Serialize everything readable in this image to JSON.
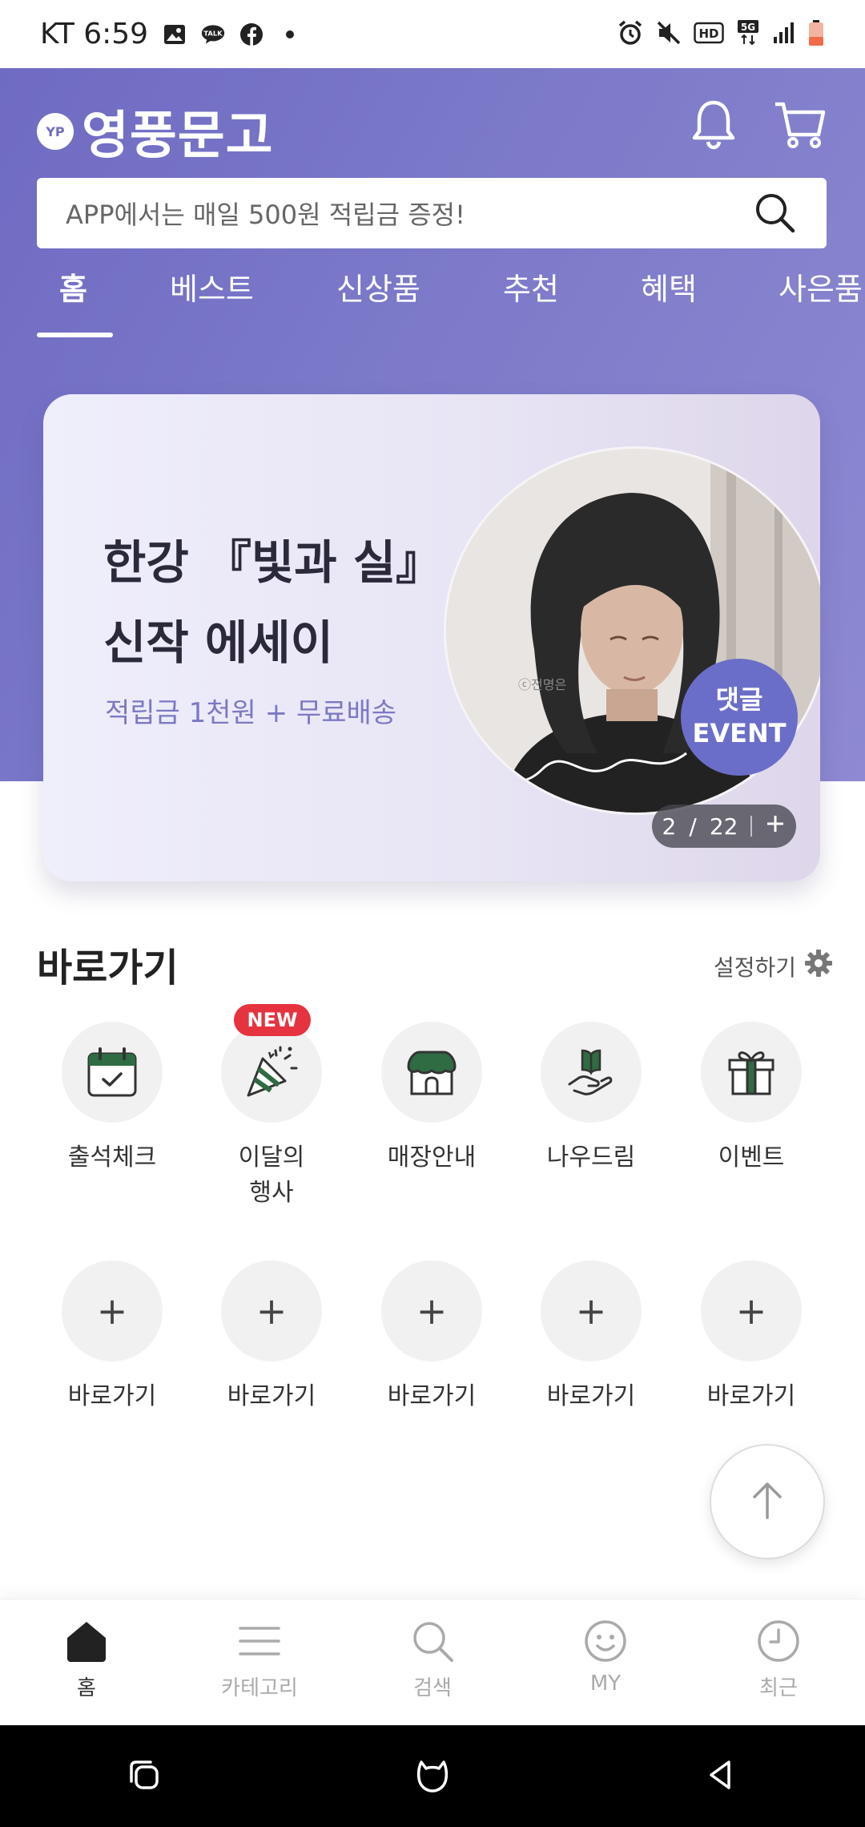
{
  "status_bar": {
    "carrier_time": "KT 6:59",
    "icons": [
      "image-icon",
      "talk-icon",
      "facebook-icon",
      "dot-icon",
      "alarm-icon",
      "mute-icon",
      "hd-icon",
      "5g-icon",
      "signal-icon",
      "battery-icon"
    ]
  },
  "header": {
    "brand_name": "영풍문고",
    "brand_logo_text": "YP",
    "search_placeholder": "APP에서는 매일 500원 적립금 증정!"
  },
  "tabs": [
    {
      "label": "홈",
      "active": true
    },
    {
      "label": "베스트"
    },
    {
      "label": "신상품"
    },
    {
      "label": "추천"
    },
    {
      "label": "혜택"
    },
    {
      "label": "사은품"
    }
  ],
  "banner": {
    "title_line1": "한강 『빛과 실』",
    "title_line2": "신작 에세이",
    "subtitle": "적립금 1천원 + 무료배송",
    "photo_credit": "ⓒ전명은",
    "badge_line1": "댓글",
    "badge_line2": "EVENT",
    "pager_current": "2",
    "pager_sep": "/",
    "pager_total": "22"
  },
  "shortcuts": {
    "title": "바로가기",
    "setting_label": "설정하기",
    "new_badge": "NEW",
    "items": [
      {
        "label": "출석체크",
        "icon": "calendar-check-icon"
      },
      {
        "label_line1": "이달의",
        "label_line2": "행사",
        "icon": "party-popper-icon"
      },
      {
        "label": "매장안내",
        "icon": "store-icon"
      },
      {
        "label": "나우드림",
        "icon": "book-hand-icon"
      },
      {
        "label": "이벤트",
        "icon": "gift-icon"
      }
    ],
    "empty_label": "바로가기"
  },
  "bottom_nav": [
    {
      "label": "홈",
      "icon": "home-icon",
      "active": true
    },
    {
      "label": "카테고리",
      "icon": "menu-icon"
    },
    {
      "label": "검색",
      "icon": "search-icon"
    },
    {
      "label": "MY",
      "icon": "smile-icon"
    },
    {
      "label": "최근",
      "icon": "clock-icon"
    }
  ],
  "colors": {
    "brand": "#6f6bc3",
    "accent_green": "#2f6b43",
    "badge_red": "#e5343f"
  }
}
